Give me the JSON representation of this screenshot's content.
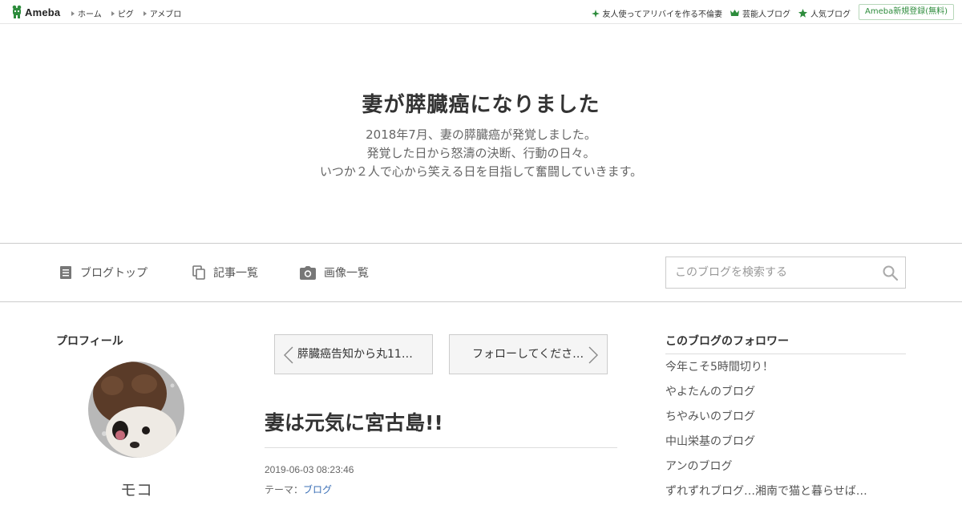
{
  "topbar": {
    "logo_text": "Ameba",
    "nav": [
      "ホーム",
      "ピグ",
      "アメブロ"
    ],
    "right_links": [
      {
        "label": "友人使ってアリバイを作る不倫妻",
        "icon": "sparkle-icon"
      },
      {
        "label": "芸能人ブログ",
        "icon": "crown-icon"
      },
      {
        "label": "人気ブログ",
        "icon": "star-icon"
      }
    ],
    "signup_label": "Ameba新規登録(無料)"
  },
  "header": {
    "title": "妻が膵臓癌になりました",
    "description": [
      "2018年7月、妻の膵臓癌が発覚しました。",
      "発覚した日から怒濤の決断、行動の日々。",
      "いつか２人で心から笑える日を目指して奮闘していきます。"
    ]
  },
  "nav": {
    "blog_top": "ブログトップ",
    "article_list": "記事一覧",
    "image_list": "画像一覧"
  },
  "search": {
    "placeholder": "このブログを検索する"
  },
  "profile": {
    "heading": "プロフィール",
    "name": "モコ"
  },
  "pager": {
    "prev": "膵臓癌告知から丸11…",
    "next": "フォローしてくださ…"
  },
  "entry": {
    "title": "妻は元気に宮古島!!",
    "date": "2019-06-03 08:23:46",
    "theme_label": "テーマ：",
    "theme_link": "ブログ"
  },
  "followers": {
    "heading": "このブログのフォロワー",
    "items": [
      "今年こそ5時間切り！",
      "やよたんのブログ",
      "ちやみいのブログ",
      "中山栄基のブログ",
      "アンのブログ",
      "ずれずれブログ…湘南で猫と暮らせば…"
    ]
  },
  "colors": {
    "ameba_green": "#2d8c3c",
    "link_blue": "#3b6fb6"
  }
}
